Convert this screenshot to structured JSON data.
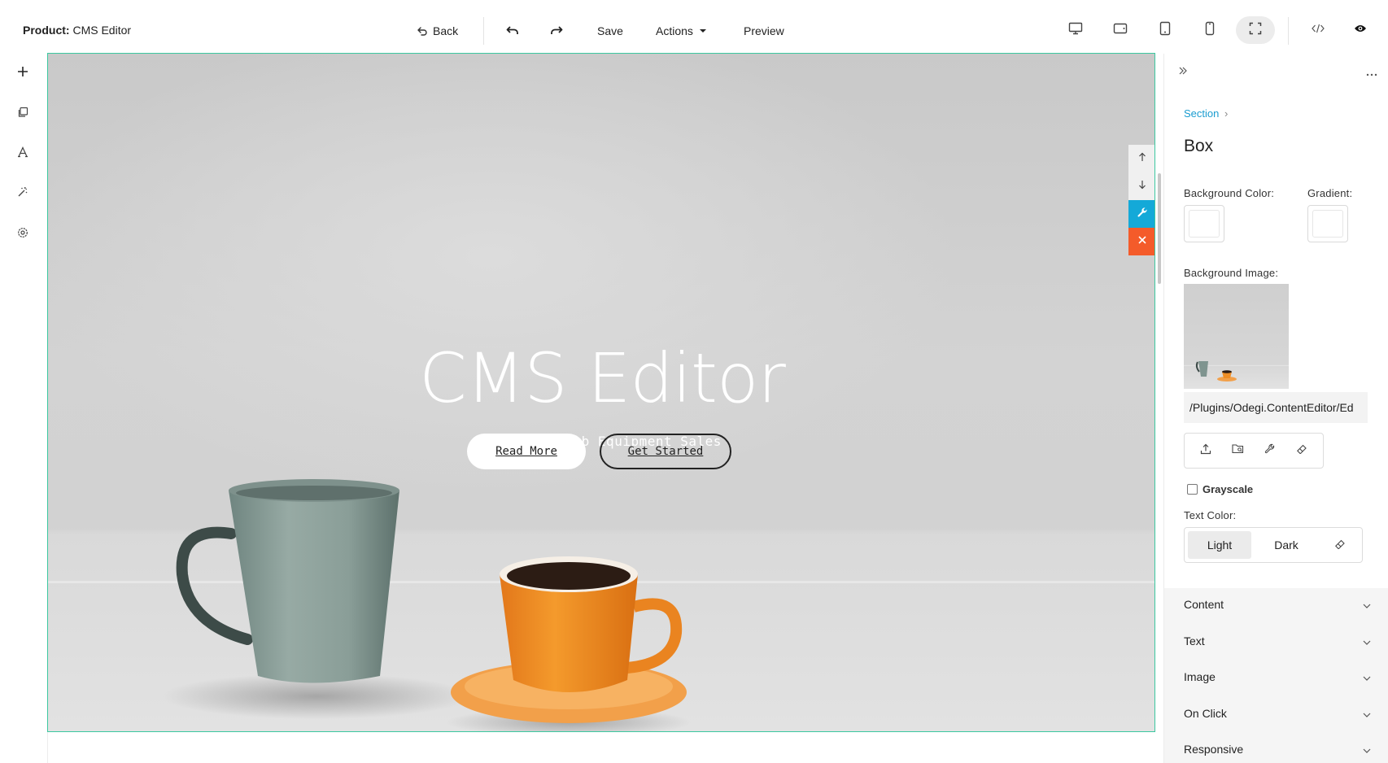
{
  "header": {
    "product_label": "Product:",
    "product_name": "CMS Editor",
    "back_label": "Back",
    "save_label": "Save",
    "actions_label": "Actions",
    "preview_label": "Preview"
  },
  "hero": {
    "title": "CMS Editor",
    "subtitle": "Built For Lab Equipment Sales",
    "read_more": "Read More",
    "get_started": "Get Started"
  },
  "panel": {
    "breadcrumb": "Section",
    "breadcrumb_sep": "›",
    "title": "Box",
    "bg_color_label": "Background Color:",
    "gradient_label": "Gradient:",
    "bg_image_label": "Background Image:",
    "bg_image_path": "/Plugins/Odegi.ContentEditor/Ed",
    "grayscale_label": "Grayscale",
    "text_color_label": "Text Color:",
    "text_color_options": [
      "Light",
      "Dark"
    ],
    "text_color_selected": "Light",
    "accordion": [
      "Content",
      "Text",
      "Image",
      "On Click",
      "Responsive"
    ]
  },
  "colors": {
    "selection_border": "#3cc8a0",
    "tool_blue": "#14a9d8",
    "tool_orange": "#f45b2a",
    "tool_green": "#3cb54a",
    "tool_yellow": "#f7b51f",
    "breadcrumb_link": "#1a9cd0"
  },
  "icons": {
    "left_rail": [
      "plus-icon",
      "copy-icon",
      "typography-icon",
      "magic-wand-icon",
      "settings-icon"
    ],
    "devices": [
      "desktop-icon",
      "tablet-landscape-icon",
      "tablet-portrait-icon",
      "mobile-icon",
      "fullscreen-icon"
    ]
  }
}
